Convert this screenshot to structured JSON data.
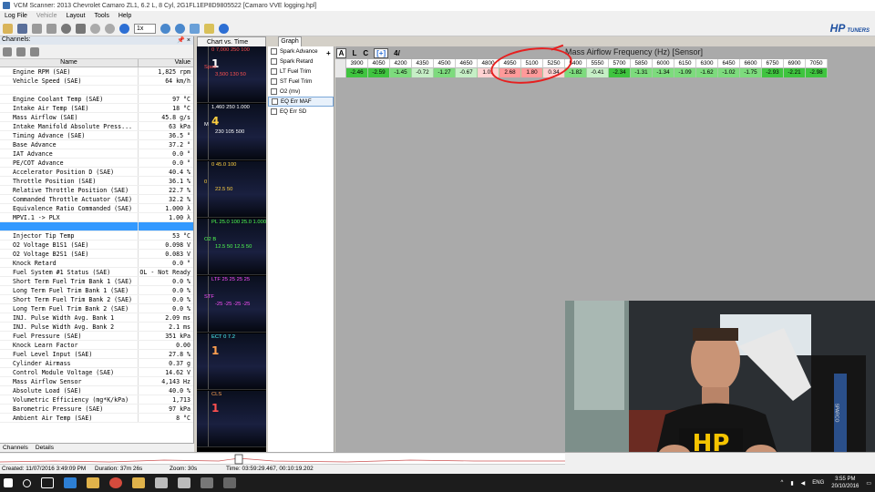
{
  "window": {
    "title": "VCM Scanner: 2013 Chevrolet Camaro ZL1, 6.2 L, 8 Cyl, 2G1FL1EP8D9805522 [Camaro VVE logging.hpl]"
  },
  "menu": [
    "Log File",
    "Vehicle",
    "Layout",
    "Tools",
    "Help"
  ],
  "toolbar": {
    "speed": "1x"
  },
  "brand": {
    "name": "HP",
    "sub": "TUNERS"
  },
  "channels": {
    "title": "Channels:",
    "pin": "📌 ×",
    "col_name": "Name",
    "col_value": "Value",
    "rows": [
      {
        "name": "Engine RPM (SAE)",
        "value": "1,825 rpm"
      },
      {
        "name": "Vehicle Speed (SAE)",
        "value": "64 km/h"
      },
      {
        "name": "",
        "value": ""
      },
      {
        "name": "Engine Coolant Temp (SAE)",
        "value": "97 °C"
      },
      {
        "name": "Intake Air Temp (SAE)",
        "value": "18 °C"
      },
      {
        "name": "Mass Airflow (SAE)",
        "value": "45.8 g/s"
      },
      {
        "name": "Intake Manifold Absolute Press...",
        "value": "63 kPa"
      },
      {
        "name": "Timing Advance (SAE)",
        "value": "36.5 °"
      },
      {
        "name": "Base Advance",
        "value": "37.2 °"
      },
      {
        "name": "IAT Advance",
        "value": "0.0 °"
      },
      {
        "name": "PE/COT Advance",
        "value": "0.0 °"
      },
      {
        "name": "Accelerator Position D (SAE)",
        "value": "40.4 %"
      },
      {
        "name": "Throttle Position (SAE)",
        "value": "36.1 %"
      },
      {
        "name": "Relative Throttle Position (SAE)",
        "value": "22.7 %"
      },
      {
        "name": "Commanded Throttle Actuator (SAE)",
        "value": "32.2 %"
      },
      {
        "name": "Equivalence Ratio Commanded (SAE)",
        "value": "1.000 λ"
      },
      {
        "name": "MPVI.1 -> PLX",
        "value": "1.00 λ"
      },
      {
        "name": "",
        "value": ""
      },
      {
        "name": "Injector Tip Temp",
        "value": "53 °C"
      },
      {
        "name": "O2 Voltage B1S1 (SAE)",
        "value": "0.098 V"
      },
      {
        "name": "O2 Voltage B2S1 (SAE)",
        "value": "0.083 V"
      },
      {
        "name": "Knock Retard",
        "value": "0.0 °"
      },
      {
        "name": "Fuel System #1 Status (SAE)",
        "value": "OL - Not Ready"
      },
      {
        "name": "Short Term Fuel Trim Bank 1 (SAE)",
        "value": "0.0 %"
      },
      {
        "name": "Long Term Fuel Trim Bank 1 (SAE)",
        "value": "0.0 %"
      },
      {
        "name": "Short Term Fuel Trim Bank 2 (SAE)",
        "value": "0.0 %"
      },
      {
        "name": "Long Term Fuel Trim Bank 2 (SAE)",
        "value": "0.0 %"
      },
      {
        "name": "INJ. Pulse Width Avg. Bank 1",
        "value": "2.09 ms"
      },
      {
        "name": "INJ. Pulse Width Avg. Bank 2",
        "value": "2.1 ms"
      },
      {
        "name": "Fuel Pressure (SAE)",
        "value": "351 kPa"
      },
      {
        "name": "Knock Learn Factor",
        "value": "0.00"
      },
      {
        "name": "Fuel Level Input (SAE)",
        "value": "27.8 %"
      },
      {
        "name": "Cylinder Airmass",
        "value": "0.37 g"
      },
      {
        "name": "Control Module Voltage (SAE)",
        "value": "14.62 V"
      },
      {
        "name": "Mass Airflow Sensor",
        "value": "4,143 Hz"
      },
      {
        "name": "Absolute Load (SAE)",
        "value": "40.0 %"
      },
      {
        "name": "Volumetric Efficiency (mg*K/kPa)",
        "value": "1,713"
      },
      {
        "name": "Barometric Pressure (SAE)",
        "value": "97 kPa"
      },
      {
        "name": "Ambient Air Temp (SAE)",
        "value": "8 °C"
      }
    ],
    "tabs": [
      "Channels",
      "Details"
    ]
  },
  "chart_vs_time": {
    "tab": "Chart vs. Time",
    "strips": [
      {
        "top": "0 7,000 250 100",
        "big": "1",
        "mid": "3,500 130 50",
        "side": "Spee"
      },
      {
        "top": "1,460 250 1.000",
        "big": "4",
        "mid": "230 105 500",
        "side": "M"
      },
      {
        "top": "0 45.0 100",
        "big": "",
        "mid": "22.5 50",
        "side": "0"
      },
      {
        "top": "PL 25.0 100 25.0 1.000",
        "big": "",
        "mid": "12.5 50 12.5 50",
        "side": "O2 B"
      },
      {
        "top": "LTF 25 25 25 25",
        "big": "",
        "mid": "-25 -25 -25 -25",
        "side": "STF"
      },
      {
        "top": "ECT 0 7.2",
        "big": "1",
        "mid": "",
        "side": ""
      },
      {
        "top": "CLS",
        "big": "1",
        "mid": "",
        "side": ""
      }
    ]
  },
  "graph_panel": {
    "tab": "Graph",
    "items": [
      "Spark Advance",
      "Spark Retard",
      "LT Fuel Trim",
      "ST Fuel Trim",
      "O2 (mv)",
      "EQ Err MAF",
      "EQ Err SD"
    ],
    "selected_index": 5
  },
  "table": {
    "title": "Mass Airflow Frequency (Hz) [Sensor]",
    "tools": [
      "+",
      "A",
      "L",
      "C",
      "[+]",
      "4/"
    ],
    "headers": [
      "3900",
      "4050",
      "4200",
      "4350",
      "4500",
      "4650",
      "4800",
      "4950",
      "5100",
      "5250",
      "5400",
      "5550",
      "5700",
      "5850",
      "6000",
      "6150",
      "6300",
      "6450",
      "6600",
      "6750",
      "6900",
      "7050"
    ],
    "values": [
      "-2.46",
      "-2.59",
      "-1.45",
      "-0.72",
      "-1.27",
      "-0.67",
      "1.01",
      "2.68",
      "1.80",
      "0.34",
      "-1.82",
      "-0.41",
      "-2.34",
      "-1.31",
      "-1.34",
      "-1.09",
      "-1.62",
      "-1.02",
      "-1.75",
      "-2.93",
      "-2.21",
      "-2.98"
    ]
  },
  "status": {
    "created": "Created: 11/07/2016 3:49:09 PM",
    "duration": "Duration: 37m 26s",
    "zoom": "Zoom: 30s",
    "time": "Time: 03:59:29.467, 00:10:19.202"
  },
  "taskbar": {
    "lang": "ENG",
    "time": "3:55 PM",
    "date": "20/10/2016"
  },
  "webcam": {
    "shirt_text": "HP",
    "seat_text": "SPARCO"
  },
  "colors": {
    "accent": "#3399ff",
    "positive": "#ff9a9a",
    "negative": "#5fd35f",
    "annotation": "#e62020"
  }
}
